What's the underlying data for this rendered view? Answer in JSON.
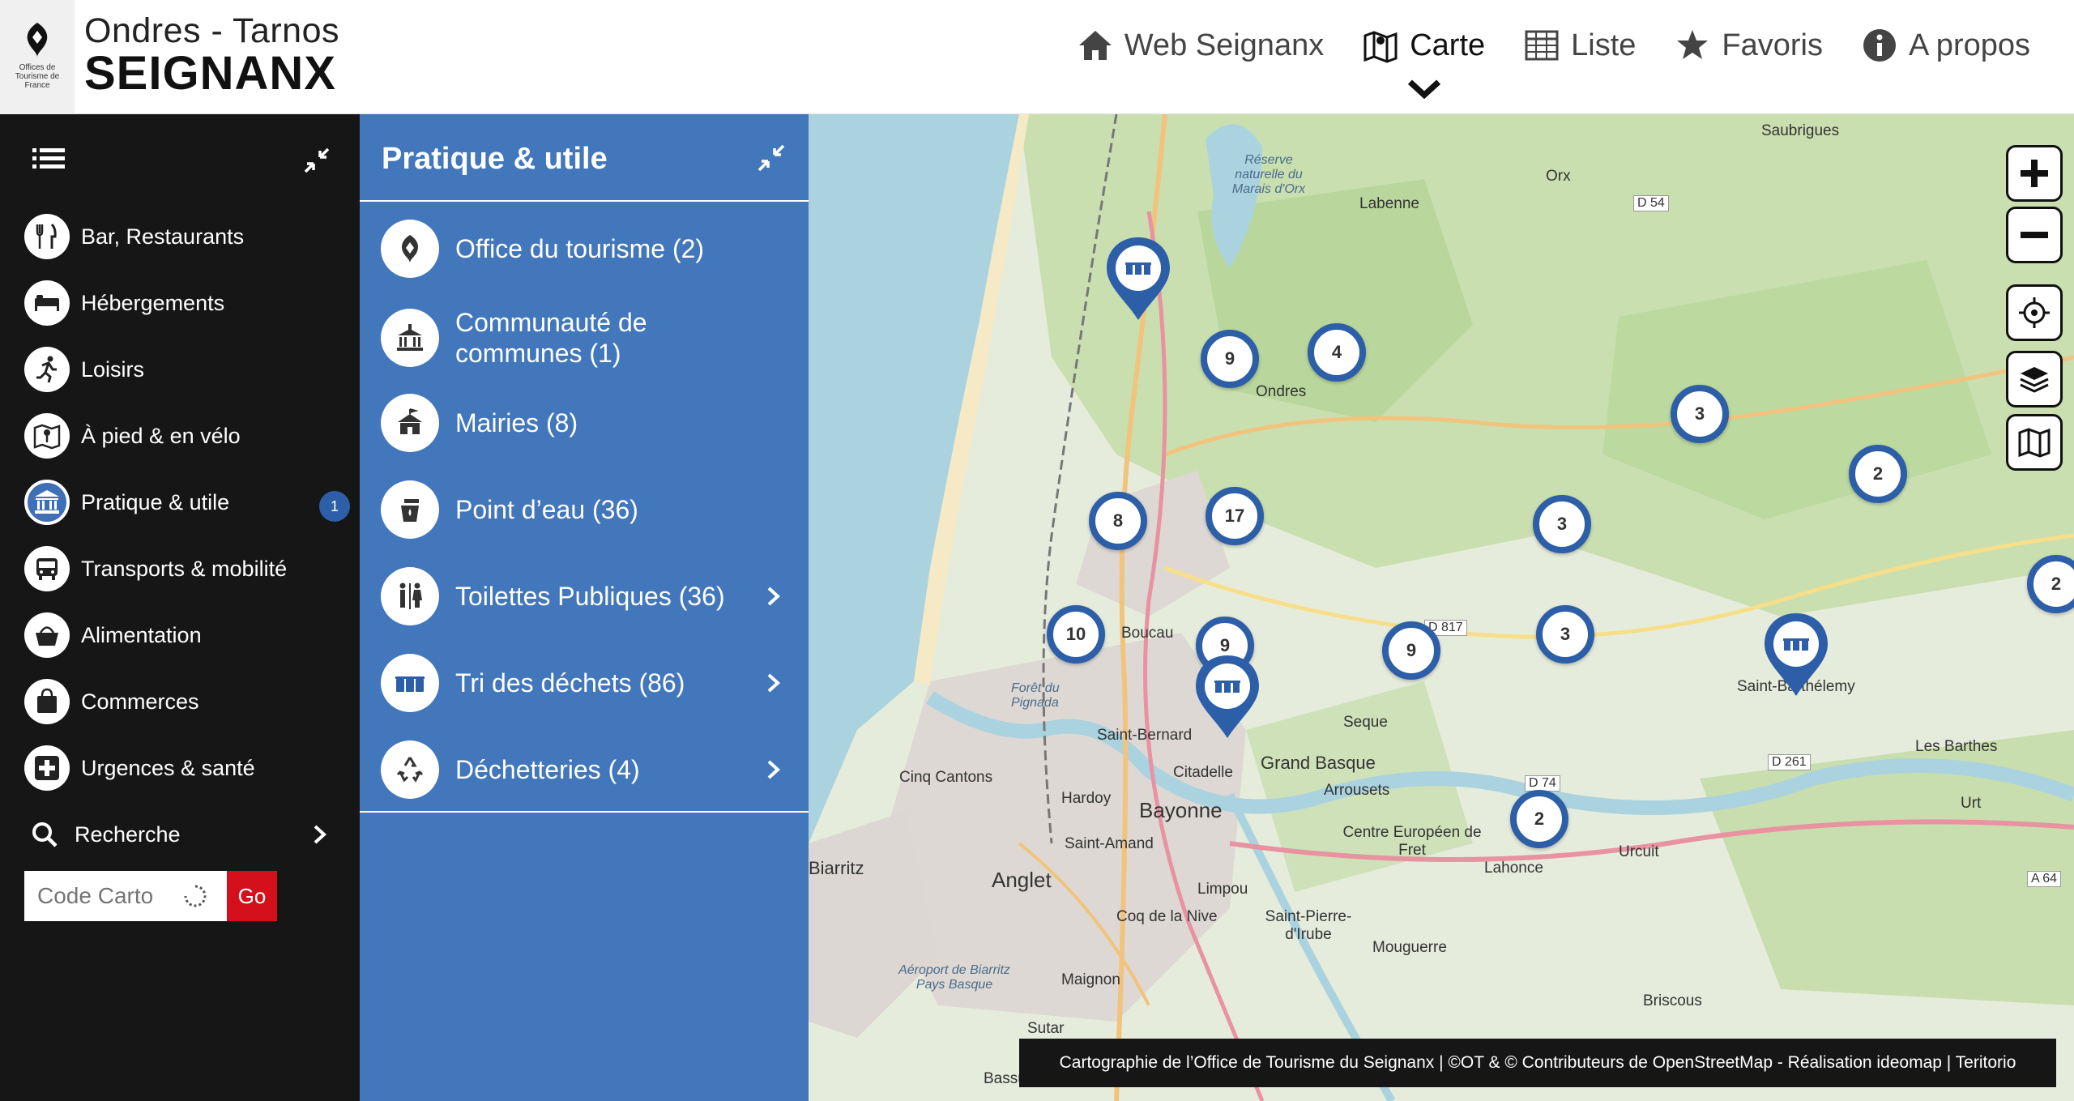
{
  "header": {
    "logo_small_text": "Offices de Tourisme de France",
    "brand_top": "Ondres - Tarnos",
    "brand_main": "SEIGNANX",
    "nav": [
      {
        "label": "Web Seignanx",
        "icon": "home-icon"
      },
      {
        "label": "Carte",
        "icon": "map-icon",
        "active": true
      },
      {
        "label": "Liste",
        "icon": "table-icon"
      },
      {
        "label": "Favoris",
        "icon": "star-icon"
      },
      {
        "label": "A propos",
        "icon": "info-icon"
      }
    ]
  },
  "sidebar": {
    "items": [
      {
        "label": "Bar, Restaurants",
        "icon": "cutlery-icon"
      },
      {
        "label": "Hébergements",
        "icon": "bed-icon"
      },
      {
        "label": "Loisirs",
        "icon": "running-icon"
      },
      {
        "label": "À pied & en vélo",
        "icon": "hiking-map-icon"
      },
      {
        "label": "Pratique & utile",
        "icon": "institution-icon",
        "active": true,
        "badge": "1"
      },
      {
        "label": "Transports & mobilité",
        "icon": "bus-icon"
      },
      {
        "label": "Alimentation",
        "icon": "basket-icon"
      },
      {
        "label": "Commerces",
        "icon": "shopping-bag-icon"
      },
      {
        "label": "Urgences & santé",
        "icon": "first-aid-icon"
      }
    ],
    "search_label": "Recherche",
    "code_placeholder": "Code Carto",
    "go_label": "Go"
  },
  "panel": {
    "title": "Pratique & utile",
    "items": [
      {
        "label": "Office du tourisme (2)",
        "icon": "tourism-office-icon",
        "chevron": false
      },
      {
        "label": "Communauté de communes (1)",
        "icon": "town-hall-icon",
        "chevron": false
      },
      {
        "label": "Mairies (8)",
        "icon": "mairie-icon",
        "chevron": false
      },
      {
        "label": "Point d’eau (36)",
        "icon": "water-tap-icon",
        "chevron": false
      },
      {
        "label": "Toilettes Publiques (36)",
        "icon": "toilets-icon",
        "chevron": true
      },
      {
        "label": "Tri des déchets (86)",
        "icon": "recycling-bins-icon",
        "chevron": true
      },
      {
        "label": "Déchetteries (4)",
        "icon": "recycle-icon",
        "chevron": true
      }
    ]
  },
  "map": {
    "clusters": [
      "9",
      "4",
      "3",
      "2",
      "8",
      "17",
      "3",
      "2",
      "10",
      "9",
      "9",
      "3",
      "2"
    ],
    "labels": [
      "Saubrigues",
      "Orx",
      "Réserve naturelle du Marais d'Orx",
      "Labenne",
      "D 54",
      "Ondres",
      "Boucau",
      "Forêt du Pignada",
      "Saint-Bernard",
      "Citadelle",
      "Grand Basque",
      "Seque",
      "Arrousets",
      "Cinq Cantons",
      "Hardoy",
      "Bayonne",
      "Saint-Amand",
      "Biarritz",
      "Anglet",
      "Limpou",
      "Coq de la Nive",
      "Saint-Pierre-d'Irube",
      "Centre Européen de Fret",
      "Lahonce",
      "Mouguerre",
      "Urcuit",
      "Briscous",
      "Saint-Barthélemy",
      "Les Barthes",
      "Urt",
      "D 261",
      "D 74",
      "A 64",
      "Maignon",
      "Aéroport de Biarritz Pays Basque",
      "Sutar",
      "Bassu",
      "D 817"
    ],
    "attribution": "Cartographie de l’Office de Tourisme du Seignanx | ©OT & © Contributeurs de OpenStreetMap - Réalisation ideomap | Teritorio"
  },
  "colors": {
    "accent": "#4277bb",
    "marker": "#2d5ea8",
    "sidebar_bg": "#161616",
    "go": "#d4101d"
  }
}
